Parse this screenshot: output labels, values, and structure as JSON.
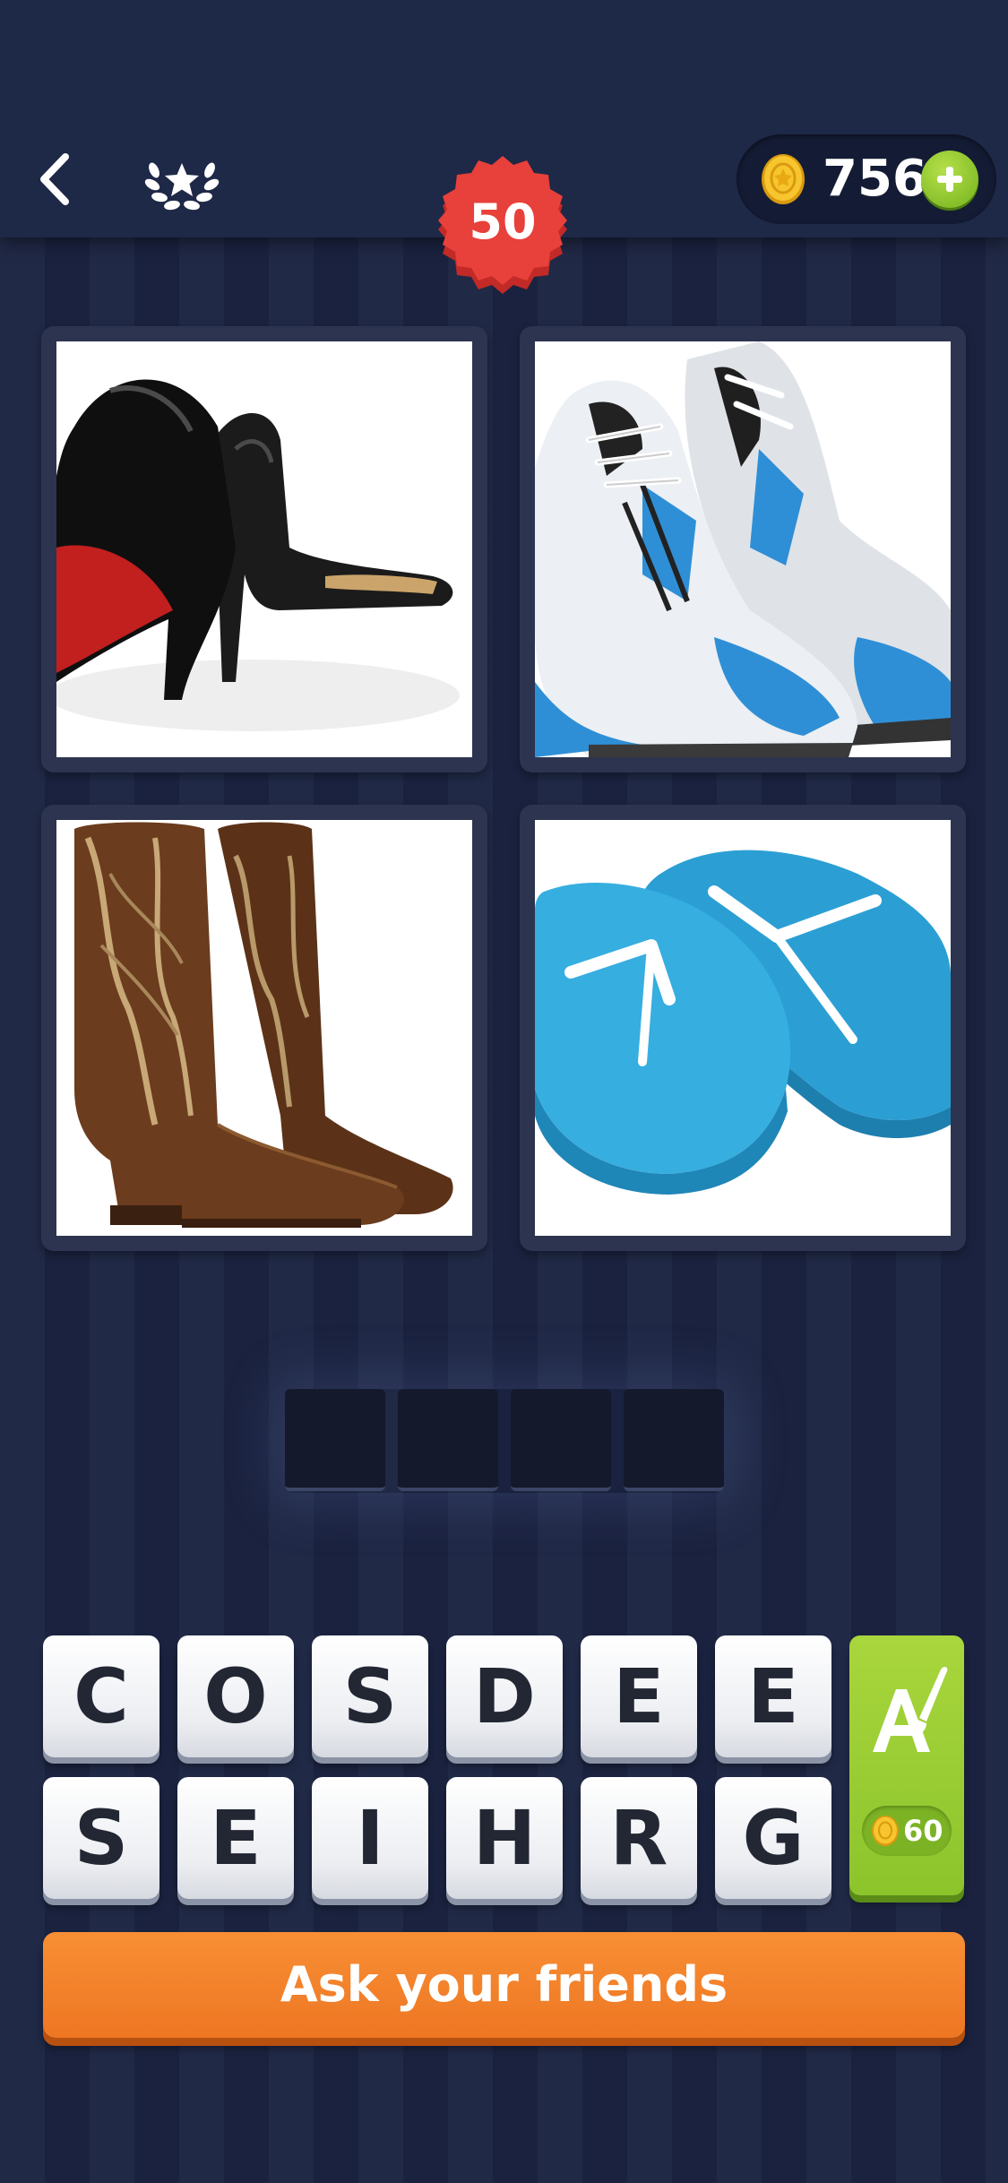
{
  "header": {
    "back_icon": "chevron-left-icon",
    "achievements_icon": "laurel-star-icon",
    "coins": "756",
    "coin_icon": "gold-coin-icon",
    "add_coins_icon": "plus-icon",
    "level": "50"
  },
  "puzzle": {
    "pictures": [
      {
        "name": "high-heels-picture"
      },
      {
        "name": "running-sneakers-picture"
      },
      {
        "name": "cowboy-boots-picture"
      },
      {
        "name": "flip-flops-picture"
      }
    ],
    "answer_length": 4,
    "answer_slots": [
      "",
      "",
      "",
      ""
    ]
  },
  "letters": {
    "row1": [
      "C",
      "O",
      "S",
      "D",
      "E",
      "E"
    ],
    "row2": [
      "S",
      "E",
      "I",
      "H",
      "R",
      "G"
    ]
  },
  "hint": {
    "icon": "letter-paintbrush-icon",
    "cost": "60"
  },
  "ask_button": {
    "label": "Ask your friends"
  },
  "colors": {
    "background": "#1b2442",
    "level_badge": "#e23a35",
    "hint_button": "#8cc42c",
    "ask_button": "#f08028"
  }
}
